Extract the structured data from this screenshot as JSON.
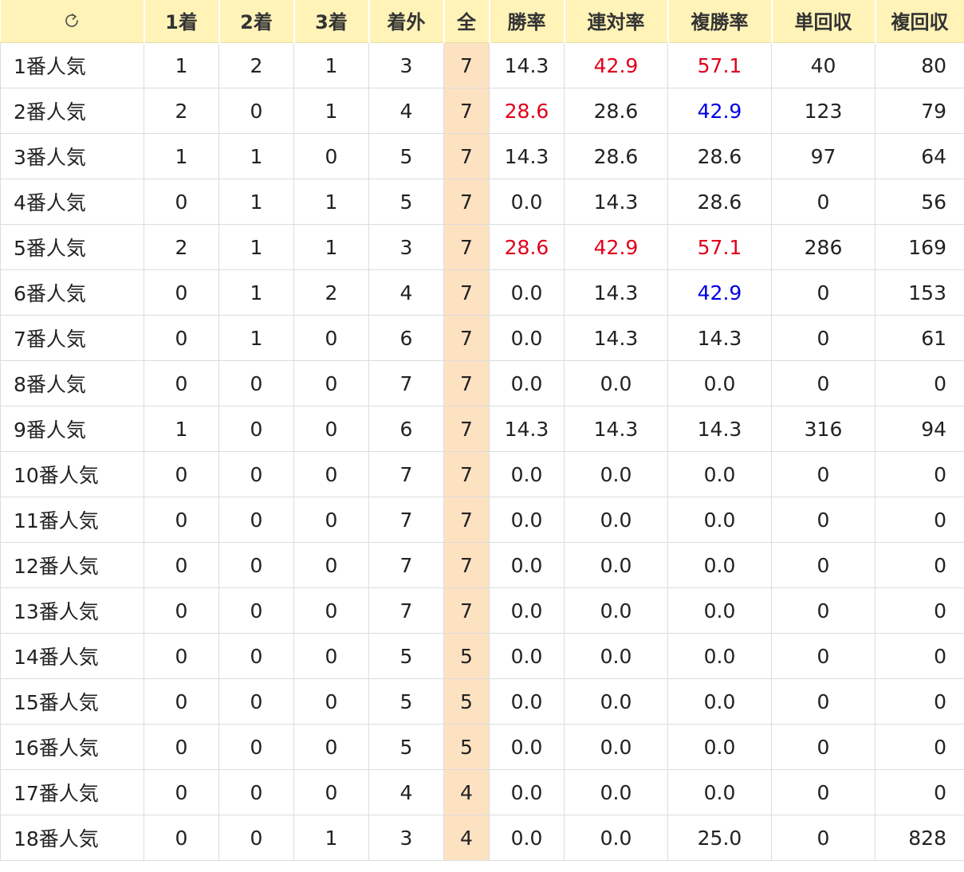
{
  "headers": [
    "1着",
    "2着",
    "3着",
    "着外",
    "全",
    "勝率",
    "連対率",
    "複勝率",
    "単回収",
    "複回収"
  ],
  "colors": {
    "header_bg": "#fff3b8",
    "total_bg": "#fde2c2",
    "high": "#e0001b",
    "mid": "#0000e0",
    "normal": "#222222"
  },
  "rows": [
    {
      "label": "1番人気",
      "cells": [
        "1",
        "2",
        "1",
        "3",
        "7",
        "14.3",
        "42.9",
        "57.1",
        "40",
        "80"
      ],
      "hl": [
        "",
        "",
        "",
        "",
        "",
        "",
        "high",
        "high",
        "",
        ""
      ]
    },
    {
      "label": "2番人気",
      "cells": [
        "2",
        "0",
        "1",
        "4",
        "7",
        "28.6",
        "28.6",
        "42.9",
        "123",
        "79"
      ],
      "hl": [
        "",
        "",
        "",
        "",
        "",
        "high",
        "",
        "mid",
        "",
        ""
      ]
    },
    {
      "label": "3番人気",
      "cells": [
        "1",
        "1",
        "0",
        "5",
        "7",
        "14.3",
        "28.6",
        "28.6",
        "97",
        "64"
      ],
      "hl": [
        "",
        "",
        "",
        "",
        "",
        "",
        "",
        "",
        "",
        ""
      ]
    },
    {
      "label": "4番人気",
      "cells": [
        "0",
        "1",
        "1",
        "5",
        "7",
        "0.0",
        "14.3",
        "28.6",
        "0",
        "56"
      ],
      "hl": [
        "",
        "",
        "",
        "",
        "",
        "",
        "",
        "",
        "",
        ""
      ]
    },
    {
      "label": "5番人気",
      "cells": [
        "2",
        "1",
        "1",
        "3",
        "7",
        "28.6",
        "42.9",
        "57.1",
        "286",
        "169"
      ],
      "hl": [
        "",
        "",
        "",
        "",
        "",
        "high",
        "high",
        "high",
        "",
        ""
      ]
    },
    {
      "label": "6番人気",
      "cells": [
        "0",
        "1",
        "2",
        "4",
        "7",
        "0.0",
        "14.3",
        "42.9",
        "0",
        "153"
      ],
      "hl": [
        "",
        "",
        "",
        "",
        "",
        "",
        "",
        "mid",
        "",
        ""
      ]
    },
    {
      "label": "7番人気",
      "cells": [
        "0",
        "1",
        "0",
        "6",
        "7",
        "0.0",
        "14.3",
        "14.3",
        "0",
        "61"
      ],
      "hl": [
        "",
        "",
        "",
        "",
        "",
        "",
        "",
        "",
        "",
        ""
      ]
    },
    {
      "label": "8番人気",
      "cells": [
        "0",
        "0",
        "0",
        "7",
        "7",
        "0.0",
        "0.0",
        "0.0",
        "0",
        "0"
      ],
      "hl": [
        "",
        "",
        "",
        "",
        "",
        "",
        "",
        "",
        "",
        ""
      ]
    },
    {
      "label": "9番人気",
      "cells": [
        "1",
        "0",
        "0",
        "6",
        "7",
        "14.3",
        "14.3",
        "14.3",
        "316",
        "94"
      ],
      "hl": [
        "",
        "",
        "",
        "",
        "",
        "",
        "",
        "",
        "",
        ""
      ]
    },
    {
      "label": "10番人気",
      "cells": [
        "0",
        "0",
        "0",
        "7",
        "7",
        "0.0",
        "0.0",
        "0.0",
        "0",
        "0"
      ],
      "hl": [
        "",
        "",
        "",
        "",
        "",
        "",
        "",
        "",
        "",
        ""
      ]
    },
    {
      "label": "11番人気",
      "cells": [
        "0",
        "0",
        "0",
        "7",
        "7",
        "0.0",
        "0.0",
        "0.0",
        "0",
        "0"
      ],
      "hl": [
        "",
        "",
        "",
        "",
        "",
        "",
        "",
        "",
        "",
        ""
      ]
    },
    {
      "label": "12番人気",
      "cells": [
        "0",
        "0",
        "0",
        "7",
        "7",
        "0.0",
        "0.0",
        "0.0",
        "0",
        "0"
      ],
      "hl": [
        "",
        "",
        "",
        "",
        "",
        "",
        "",
        "",
        "",
        ""
      ]
    },
    {
      "label": "13番人気",
      "cells": [
        "0",
        "0",
        "0",
        "7",
        "7",
        "0.0",
        "0.0",
        "0.0",
        "0",
        "0"
      ],
      "hl": [
        "",
        "",
        "",
        "",
        "",
        "",
        "",
        "",
        "",
        ""
      ]
    },
    {
      "label": "14番人気",
      "cells": [
        "0",
        "0",
        "0",
        "5",
        "5",
        "0.0",
        "0.0",
        "0.0",
        "0",
        "0"
      ],
      "hl": [
        "",
        "",
        "",
        "",
        "",
        "",
        "",
        "",
        "",
        ""
      ]
    },
    {
      "label": "15番人気",
      "cells": [
        "0",
        "0",
        "0",
        "5",
        "5",
        "0.0",
        "0.0",
        "0.0",
        "0",
        "0"
      ],
      "hl": [
        "",
        "",
        "",
        "",
        "",
        "",
        "",
        "",
        "",
        ""
      ]
    },
    {
      "label": "16番人気",
      "cells": [
        "0",
        "0",
        "0",
        "5",
        "5",
        "0.0",
        "0.0",
        "0.0",
        "0",
        "0"
      ],
      "hl": [
        "",
        "",
        "",
        "",
        "",
        "",
        "",
        "",
        "",
        ""
      ]
    },
    {
      "label": "17番人気",
      "cells": [
        "0",
        "0",
        "0",
        "4",
        "4",
        "0.0",
        "0.0",
        "0.0",
        "0",
        "0"
      ],
      "hl": [
        "",
        "",
        "",
        "",
        "",
        "",
        "",
        "",
        "",
        ""
      ]
    },
    {
      "label": "18番人気",
      "cells": [
        "0",
        "0",
        "1",
        "3",
        "4",
        "0.0",
        "0.0",
        "25.0",
        "0",
        "828"
      ],
      "hl": [
        "",
        "",
        "",
        "",
        "",
        "",
        "",
        "",
        "",
        ""
      ]
    }
  ]
}
